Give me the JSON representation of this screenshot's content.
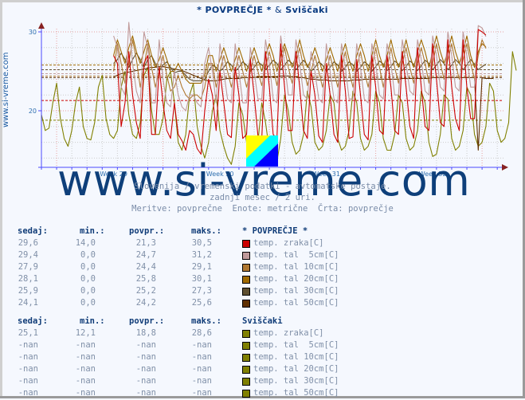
{
  "title": {
    "part1": "* POVPREČJE *",
    "amp": "&",
    "part2": "Sviščaki"
  },
  "side_label": "www.si-vreme.com",
  "watermark": "www.si-vreme.com",
  "subtitle_lines": [
    "Slovenija / vremenski podatki - avtomatske postaje.",
    "zadnji mesec / 2 uri.",
    "Meritve: povprečne  Enote: metrične  Črta: povprečje"
  ],
  "chart_data": {
    "type": "line",
    "title": "* POVPREČJE * & Sviščaki",
    "xlabel": "",
    "ylabel": "",
    "ylim": [
      12.8,
      31.2
    ],
    "yticks": [
      20,
      30
    ],
    "xticks": [
      "Week 29",
      "Week 30",
      "Week 31",
      "Week 32"
    ],
    "x_unit": "days",
    "x_range_days": [
      0,
      30.2
    ],
    "xtick_days": [
      4.75,
      11.75,
      18.75,
      25.75
    ],
    "sample_step_days": 0.25,
    "grid": true,
    "legend": "below",
    "series": [
      {
        "name": "* POVPREČJE * temp. zraka[C]",
        "color": "#cc0000",
        "avg": 21.3,
        "start_day": 4.75,
        "values": [
          27,
          26,
          18,
          21,
          27.5,
          22,
          18.5,
          16.5,
          26,
          27,
          17,
          17,
          25.5,
          21,
          17.5,
          16.5,
          21,
          17,
          16.2,
          15,
          17.5,
          17,
          15.2,
          14.5,
          20,
          24,
          22,
          17.5,
          25,
          21,
          17,
          16.6,
          25.5,
          22,
          16.5,
          17,
          26.5,
          22,
          16.8,
          16.5,
          27.5,
          23,
          17,
          16.5,
          28.5,
          23,
          17.5,
          17.5,
          27.5,
          23,
          17.5,
          16.5,
          25,
          22,
          16.8,
          16,
          26,
          22,
          17,
          16,
          27,
          22.5,
          16.5,
          16.7,
          26.5,
          22,
          17,
          16.3,
          27,
          23,
          17.5,
          17,
          27,
          23,
          17.5,
          17,
          27.5,
          23,
          18,
          16.5,
          28,
          23,
          18,
          17.5,
          28.5,
          24,
          18.5,
          18,
          29,
          23,
          19,
          17.5,
          29,
          23,
          19,
          19,
          30.3,
          30,
          29.6
        ]
      },
      {
        "name": "* POVPREČJE * temp. tal 5cm[C]",
        "color": "#c09a9a",
        "avg": 24.7,
        "start_day": 4.75,
        "values": [
          29.5,
          28,
          23,
          22,
          31.2,
          26,
          22.5,
          21,
          30,
          28,
          21,
          21,
          29,
          24,
          21,
          20.5,
          25,
          22,
          20.5,
          20,
          22,
          22,
          21,
          20.5,
          26,
          28,
          25,
          21,
          28.5,
          25,
          21.5,
          21,
          28.5,
          25,
          21,
          21,
          28,
          25,
          21.5,
          21.5,
          29,
          26,
          21.5,
          21,
          29.5,
          26,
          22,
          22,
          29,
          26,
          22,
          21.5,
          27.5,
          25,
          21.5,
          21,
          28.5,
          25,
          21.5,
          21,
          28.5,
          25.5,
          21.5,
          21.5,
          28.5,
          25.5,
          21.5,
          21,
          28.5,
          26,
          22,
          21.5,
          28.5,
          26,
          22,
          22,
          29,
          26,
          22.5,
          22,
          29,
          26.5,
          22.5,
          22,
          29.5,
          27,
          23,
          22.5,
          30,
          27,
          23,
          22.5,
          30,
          27,
          23,
          23,
          30.8,
          30.5,
          29.4
        ]
      },
      {
        "name": "* POVPREČJE * temp. tal 10cm[C]",
        "color": "#b07830",
        "avg": 24.4,
        "start_day": 4.75,
        "values": [
          25,
          28.5,
          26,
          23.5,
          26,
          29,
          26.5,
          23,
          25.5,
          28.5,
          25.5,
          23,
          25,
          27,
          24.5,
          22.5,
          23,
          24.5,
          23,
          22,
          21.5,
          22,
          22,
          21.5,
          23,
          26,
          26,
          23,
          25,
          27,
          25,
          23,
          25,
          27,
          25,
          23,
          25,
          27,
          25,
          23.2,
          25.5,
          27.5,
          25.5,
          23.2,
          26,
          28,
          25.5,
          23.5,
          26,
          28,
          25.5,
          23.2,
          25,
          27,
          25,
          23,
          25,
          27,
          25,
          23,
          25.5,
          27.5,
          25,
          23,
          25.5,
          27.5,
          25,
          23,
          25.5,
          28,
          25.5,
          23,
          25.5,
          28,
          25.5,
          23.5,
          26,
          28,
          25.5,
          23.5,
          26,
          28,
          26,
          23.5,
          26,
          28.5,
          26,
          24,
          26.5,
          28.5,
          26,
          24,
          26.5,
          28.5,
          26,
          24,
          27,
          29,
          27.9
        ]
      },
      {
        "name": "* POVPREČJE * temp. tal 20cm[C]",
        "color": "#a06a00",
        "avg": 25.8,
        "start_day": 4.75,
        "values": [
          27,
          29,
          27.5,
          26,
          28,
          29.5,
          27.5,
          26,
          27.5,
          29,
          27,
          25.5,
          26.5,
          28,
          26.5,
          25,
          25,
          26,
          25,
          24,
          23.5,
          23.5,
          23.5,
          23.5,
          24.5,
          27,
          27,
          25,
          26.5,
          28,
          26.5,
          25,
          26.5,
          28,
          26.5,
          25,
          26.5,
          28,
          26.5,
          25,
          27,
          28.5,
          27,
          25,
          27,
          28.5,
          27,
          25.5,
          27,
          29,
          27,
          25.5,
          26.5,
          28,
          26.5,
          25,
          26.5,
          28,
          26.5,
          25,
          27,
          28.5,
          26.5,
          25,
          27,
          28.5,
          27,
          25,
          27,
          29,
          27,
          25.5,
          27,
          29,
          27,
          25.5,
          27,
          29,
          27,
          25.5,
          27.5,
          29,
          27.5,
          25.5,
          27.5,
          29.5,
          27.5,
          26,
          27.5,
          29.5,
          27.5,
          26,
          27.5,
          29.5,
          27,
          25.5,
          27.5,
          28.5,
          28.1
        ]
      },
      {
        "name": "* POVPREČJE * temp. tal 30cm[C]",
        "color": "#605030",
        "avg": 25.2,
        "start_day": 4.75,
        "values": [
          26,
          26.5,
          27.3,
          26.5,
          25.5,
          26.5,
          27.3,
          26.5,
          25.5,
          26.5,
          27,
          26,
          25,
          25.8,
          26.2,
          25.5,
          24.8,
          25,
          25,
          24.5,
          24,
          23.8,
          23.8,
          23.8,
          24,
          25,
          25.8,
          25.5,
          25,
          25.5,
          26.2,
          25.8,
          25,
          25.5,
          26.2,
          25.8,
          25,
          25.5,
          26.2,
          25.8,
          25.2,
          25.8,
          26.4,
          26,
          25.2,
          25.8,
          26.4,
          26,
          25.2,
          25.8,
          26.4,
          25.8,
          25,
          25.5,
          26.2,
          25.8,
          25,
          25.5,
          26.2,
          25.8,
          25,
          25.5,
          26.2,
          25.8,
          25,
          25.5,
          26.2,
          25.8,
          25,
          25.6,
          26.3,
          25.9,
          25.1,
          25.6,
          26.3,
          25.9,
          25.1,
          25.6,
          26.3,
          25.9,
          25.1,
          25.7,
          26.4,
          26,
          25.2,
          25.8,
          26.5,
          26,
          25.2,
          25.8,
          26.5,
          26,
          25.2,
          25.8,
          26.5,
          25.9,
          25.2,
          25.6,
          25.9
        ]
      },
      {
        "name": "* POVPREČJE * temp. tal 50cm[C]",
        "color": "#603000",
        "avg": 24.2,
        "start_day": 4.75,
        "values": [
          24.3,
          24.5,
          24.7,
          24.8,
          24.9,
          25,
          25.1,
          25.2,
          25.3,
          25.4,
          25.5,
          25.5,
          25.6,
          25.6,
          25.5,
          25.4,
          25.3,
          25.2,
          25.1,
          24.9,
          24.7,
          24.5,
          24.3,
          24.1,
          23.9,
          23.8,
          23.8,
          23.8,
          23.9,
          24,
          24.1,
          24.1,
          24.1,
          24.1,
          24.2,
          24.2,
          24.2,
          24.2,
          24.3,
          24.3,
          24.3,
          24.3,
          24.3,
          24.3,
          24.4,
          24.4,
          24.4,
          24.3,
          24.3,
          24.2,
          24.2,
          24.1,
          24,
          24,
          23.9,
          23.9,
          23.9,
          23.8,
          23.8,
          23.8,
          23.8,
          23.8,
          23.8,
          23.9,
          23.9,
          23.9,
          24,
          24,
          24,
          24,
          24,
          24,
          24,
          24,
          24,
          24,
          24.1,
          24.1,
          24.1,
          24.1,
          24.1,
          24.1,
          24.1,
          24.1,
          24.2,
          24.2,
          24.2,
          24.2,
          24.2,
          24.2,
          24.2,
          24.2,
          24.2,
          24.2,
          24.2,
          24.2,
          15,
          24.2,
          24.1,
          24.1,
          24.1
        ]
      },
      {
        "name": "Sviščaki temp. zraka[C]",
        "color": "#808000",
        "avg": 18.8,
        "start_day": 0,
        "values": [
          19.5,
          17.5,
          17.8,
          21,
          23.5,
          19,
          16.5,
          15.5,
          17.5,
          21,
          23,
          18,
          16.5,
          16.3,
          18.5,
          23,
          24.5,
          19,
          17,
          16.5,
          17.5,
          23,
          25,
          19.5,
          17,
          16.5,
          18.5,
          24.5,
          25.5,
          20,
          17,
          17,
          19,
          24,
          25,
          21,
          16,
          15,
          17,
          22,
          23.5,
          18,
          15.5,
          14,
          16,
          20,
          22,
          17.5,
          15.5,
          14,
          13.2,
          15.5,
          21,
          19.5,
          16,
          14,
          14.5,
          16,
          21,
          18.5,
          15,
          13.5,
          13.5,
          16.5,
          22,
          20,
          16,
          14.5,
          15,
          17,
          22.5,
          20.5,
          16,
          15,
          15.5,
          17.5,
          22,
          21,
          16.5,
          15,
          15.5,
          17.5,
          22.5,
          21,
          16.5,
          15,
          15.5,
          17,
          22.5,
          21,
          16.5,
          15,
          15,
          17,
          22,
          21,
          16.5,
          15,
          15.5,
          17.5,
          22.5,
          21,
          16,
          14.2,
          14.5,
          17,
          22,
          21.5,
          16.5,
          15,
          15.5,
          17.5,
          23,
          22,
          17,
          15.5,
          16,
          18,
          23.5,
          22.5,
          17.5,
          16,
          16.5,
          18.5,
          27.5,
          25.1
        ]
      }
    ]
  },
  "table": {
    "headers": {
      "now": "sedaj:",
      "min": "min.:",
      "avg": "povpr.:",
      "max": "maks.:"
    },
    "groups": [
      {
        "title": "* POVPREČJE *",
        "rows": [
          {
            "now": "29,6",
            "min": "14,0",
            "avg": "21,3",
            "max": "30,5",
            "color": "#cc0000",
            "label": "temp. zraka[C]"
          },
          {
            "now": "29,4",
            "min": "0,0",
            "avg": "24,7",
            "max": "31,2",
            "color": "#c09a9a",
            "label": "temp. tal  5cm[C]"
          },
          {
            "now": "27,9",
            "min": "0,0",
            "avg": "24,4",
            "max": "29,1",
            "color": "#b07830",
            "label": "temp. tal 10cm[C]"
          },
          {
            "now": "28,1",
            "min": "0,0",
            "avg": "25,8",
            "max": "30,1",
            "color": "#a06a00",
            "label": "temp. tal 20cm[C]"
          },
          {
            "now": "25,9",
            "min": "0,0",
            "avg": "25,2",
            "max": "27,3",
            "color": "#605030",
            "label": "temp. tal 30cm[C]"
          },
          {
            "now": "24,1",
            "min": "0,0",
            "avg": "24,2",
            "max": "25,6",
            "color": "#603000",
            "label": "temp. tal 50cm[C]"
          }
        ]
      },
      {
        "title": "Sviščaki",
        "rows": [
          {
            "now": "25,1",
            "min": "12,1",
            "avg": "18,8",
            "max": "28,6",
            "color": "#808000",
            "label": "temp. zraka[C]"
          },
          {
            "now": "-nan",
            "min": "-nan",
            "avg": "-nan",
            "max": "-nan",
            "color": "#808000",
            "label": "temp. tal  5cm[C]"
          },
          {
            "now": "-nan",
            "min": "-nan",
            "avg": "-nan",
            "max": "-nan",
            "color": "#808000",
            "label": "temp. tal 10cm[C]"
          },
          {
            "now": "-nan",
            "min": "-nan",
            "avg": "-nan",
            "max": "-nan",
            "color": "#808000",
            "label": "temp. tal 20cm[C]"
          },
          {
            "now": "-nan",
            "min": "-nan",
            "avg": "-nan",
            "max": "-nan",
            "color": "#808000",
            "label": "temp. tal 30cm[C]"
          },
          {
            "now": "-nan",
            "min": "-nan",
            "avg": "-nan",
            "max": "-nan",
            "color": "#808000",
            "label": "temp. tal 50cm[C]"
          }
        ]
      }
    ]
  }
}
